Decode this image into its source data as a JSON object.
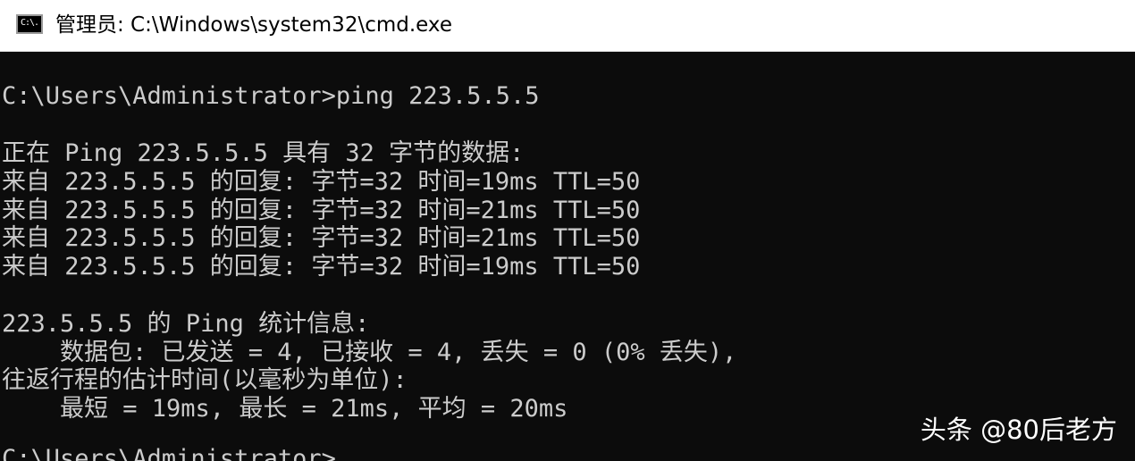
{
  "window": {
    "title": "管理员: C:\\Windows\\system32\\cmd.exe",
    "icon": "cmd-console-icon",
    "icon_glyph": "C:\\."
  },
  "console": {
    "lines": [
      "C:\\Users\\Administrator>ping 223.5.5.5",
      "正在 Ping 223.5.5.5 具有 32 字节的数据:",
      "来自 223.5.5.5 的回复: 字节=32 时间=19ms TTL=50",
      "来自 223.5.5.5 的回复: 字节=32 时间=21ms TTL=50",
      "来自 223.5.5.5 的回复: 字节=32 时间=21ms TTL=50",
      "来自 223.5.5.5 的回复: 字节=32 时间=19ms TTL=50",
      "223.5.5.5 的 Ping 统计信息:",
      "    数据包: 已发送 = 4, 已接收 = 4, 丢失 = 0 (0% 丢失),",
      "往返行程的估计时间(以毫秒为单位):",
      "    最短 = 19ms, 最长 = 21ms, 平均 = 20ms",
      "C:\\Users\\Administrator>"
    ]
  },
  "watermark": {
    "text": "头条 @80后老方"
  },
  "colors": {
    "console_background": "#0c0c0c",
    "console_text": "#cccccc",
    "titlebar_background": "#ffffff"
  }
}
